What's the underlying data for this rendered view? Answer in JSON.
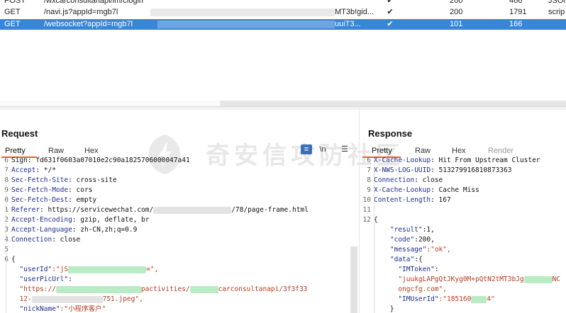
{
  "history": {
    "rows": [
      {
        "method": "POST",
        "url": "/wxcarconsultanapi/im/clogin",
        "check": "✔",
        "status": "200",
        "length": "466",
        "mime": "JSON"
      },
      {
        "method": "GET",
        "url": "/navi.js?appId=mgb7l",
        "url_tail": "MT3b!gid...",
        "check": "✔",
        "status": "200",
        "length": "1791",
        "mime": "scrip"
      },
      {
        "method": "GET",
        "url": "/websocket?appId=mgb7l",
        "url_tail": "uuiT3...",
        "check": "✔",
        "status": "101",
        "length": "166",
        "mime": ""
      }
    ]
  },
  "request": {
    "title": "Request",
    "tabs": [
      "Pretty",
      "Raw",
      "Hex"
    ],
    "newline_label": "\\n",
    "lines": [
      {
        "n": "6",
        "text": "Sign: fd631f0603a07010e2c90a1825706000047a41"
      },
      {
        "n": "7",
        "key": "Accept",
        "val": ": */*"
      },
      {
        "n": "8",
        "key": "Sec-Fetch-Site",
        "val": ": cross-site"
      },
      {
        "n": "9",
        "key": "Sec-Fetch-Mode",
        "val": ": cors"
      },
      {
        "n": "0",
        "key": "Sec-Fetch-Dest",
        "val": ": empty"
      },
      {
        "n": "1",
        "key": "Referer",
        "val": ": https://servicewechat.com/",
        "tail": "/78/page-frame.html"
      },
      {
        "n": "2",
        "key": "Accept-Encoding",
        "val": ": gzip, deflate, br"
      },
      {
        "n": "3",
        "key": "Accept-Language",
        "val": ": zh-CN,zh;q=0.9"
      },
      {
        "n": "4",
        "key": "Connection",
        "val": ": close"
      },
      {
        "n": "5",
        "text": ""
      },
      {
        "n": "6",
        "text": "{"
      },
      {
        "n": "",
        "json_key": "\"userId\"",
        "json_val": ":\"jS",
        "json_tail": "=\","
      },
      {
        "n": "",
        "json_key": "\"userPicUrl\"",
        "json_val": ":"
      },
      {
        "n": "",
        "text": "  \"https://",
        "tail": "pactivities/",
        "tail2": "carconsultanapi/3f3f33"
      },
      {
        "n": "",
        "text": "  12-",
        "tail": "751.jpeg\","
      },
      {
        "n": "",
        "json_key": "\"nickName\"",
        "json_val": ":\"小程序客户\""
      }
    ]
  },
  "response": {
    "title": "Response",
    "tabs": [
      "Pretty",
      "Raw",
      "Hex",
      "Render"
    ],
    "lines": [
      {
        "n": "6",
        "key": "X-Cache-Lookup",
        "val": ": Hit From Upstream Cluster"
      },
      {
        "n": "7",
        "key": "X-NWS-LOG-UUID",
        "val": ": 513279916810873363"
      },
      {
        "n": "8",
        "key": "Connection",
        "val": ": close"
      },
      {
        "n": "9",
        "key": "X-Cache-Lookup",
        "val": ": Cache Miss"
      },
      {
        "n": "10",
        "key": "Content-Length",
        "val": ": 167"
      },
      {
        "n": "11",
        "text": ""
      },
      {
        "n": "12",
        "text": "{"
      },
      {
        "n": "",
        "json_key": "\"result\"",
        "json_val": ":1,"
      },
      {
        "n": "",
        "json_key": "\"code\"",
        "json_val": ":200,"
      },
      {
        "n": "",
        "json_key": "\"message\"",
        "json_val": ":\"ok\","
      },
      {
        "n": "",
        "json_key": "\"data\"",
        "json_val": ":{"
      },
      {
        "n": "",
        "json_key": "\"IMToken\"",
        "json_val": ":"
      },
      {
        "n": "",
        "text": "      \"juukgLAPgQtJKyg0M+pQtN2tMT3bJg",
        "tail": "NC"
      },
      {
        "n": "",
        "text": "      ongcfg.com\","
      },
      {
        "n": "",
        "json_key": "\"IMUserId\"",
        "json_val": ":\"185160",
        "json_tail": "4\""
      },
      {
        "n": "",
        "text": "    }"
      }
    ]
  },
  "watermark": "奇安信攻防社区",
  "colors": {
    "accent": "#e8612c",
    "selection": "#3b86d4",
    "key": "#1d2c8c",
    "string": "#b53b1e"
  }
}
